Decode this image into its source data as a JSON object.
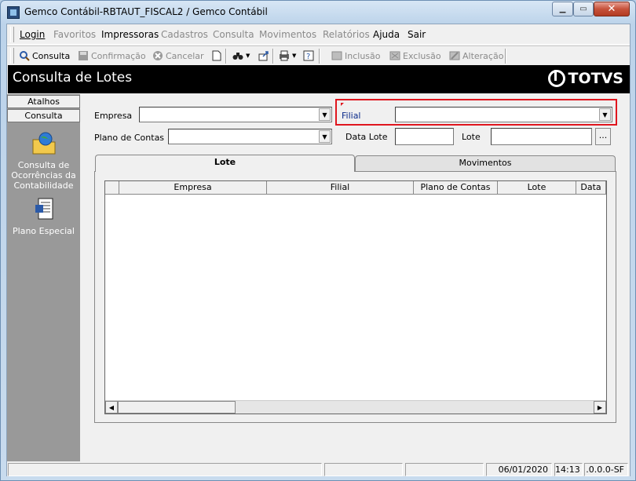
{
  "window": {
    "title": "Gemco Contábil-RBTAUT_FISCAL2 / Gemco Contábil"
  },
  "menu": [
    {
      "label": "Login",
      "enabled": true
    },
    {
      "label": "Favoritos",
      "enabled": false
    },
    {
      "label": "Impressoras",
      "enabled": true
    },
    {
      "label": "Cadastros",
      "enabled": false
    },
    {
      "label": "Consulta",
      "enabled": false
    },
    {
      "label": "Movimentos",
      "enabled": false
    },
    {
      "label": "Relatórios",
      "enabled": false
    },
    {
      "label": "Ajuda",
      "enabled": true
    },
    {
      "label": "Sair",
      "enabled": true
    }
  ],
  "toolbar": {
    "consulta": "Consulta",
    "confirmacao": "Confirmação",
    "cancelar": "Cancelar",
    "inclusao": "Inclusão",
    "exclusao": "Exclusão",
    "alteracao": "Alteração"
  },
  "header": {
    "title": "Consulta de Lotes",
    "logo": "TOTVS"
  },
  "sidebar": {
    "tabs": [
      "Atalhos",
      "Consulta"
    ],
    "entries": [
      {
        "label": "Consulta de Ocorrências da Contabilidade",
        "icon": "folder-globe-icon"
      },
      {
        "label": "Plano Especial",
        "icon": "document-icon"
      }
    ]
  },
  "form": {
    "empresa_label": "Empresa",
    "empresa_value": "",
    "filial_label": "Filial",
    "filial_value": "",
    "plano_label": "Plano de Contas",
    "plano_value": "",
    "data_lote_label": "Data Lote",
    "data_lote_value": "",
    "lote_label": "Lote",
    "lote_value": "",
    "lookup_button": "..."
  },
  "tabs": [
    {
      "label": "Lote",
      "active": true
    },
    {
      "label": "Movimentos",
      "active": false
    }
  ],
  "grid": {
    "columns": [
      "Empresa",
      "Filial",
      "Plano de Contas",
      "Lote",
      "Data"
    ],
    "rows": []
  },
  "status": {
    "date": "06/01/2020",
    "time": "14:13",
    "version": ".0.0.0-SF"
  },
  "colors": {
    "highlight": "#e0161e",
    "header_bg": "#000000",
    "sidebar_bg": "#999999"
  }
}
